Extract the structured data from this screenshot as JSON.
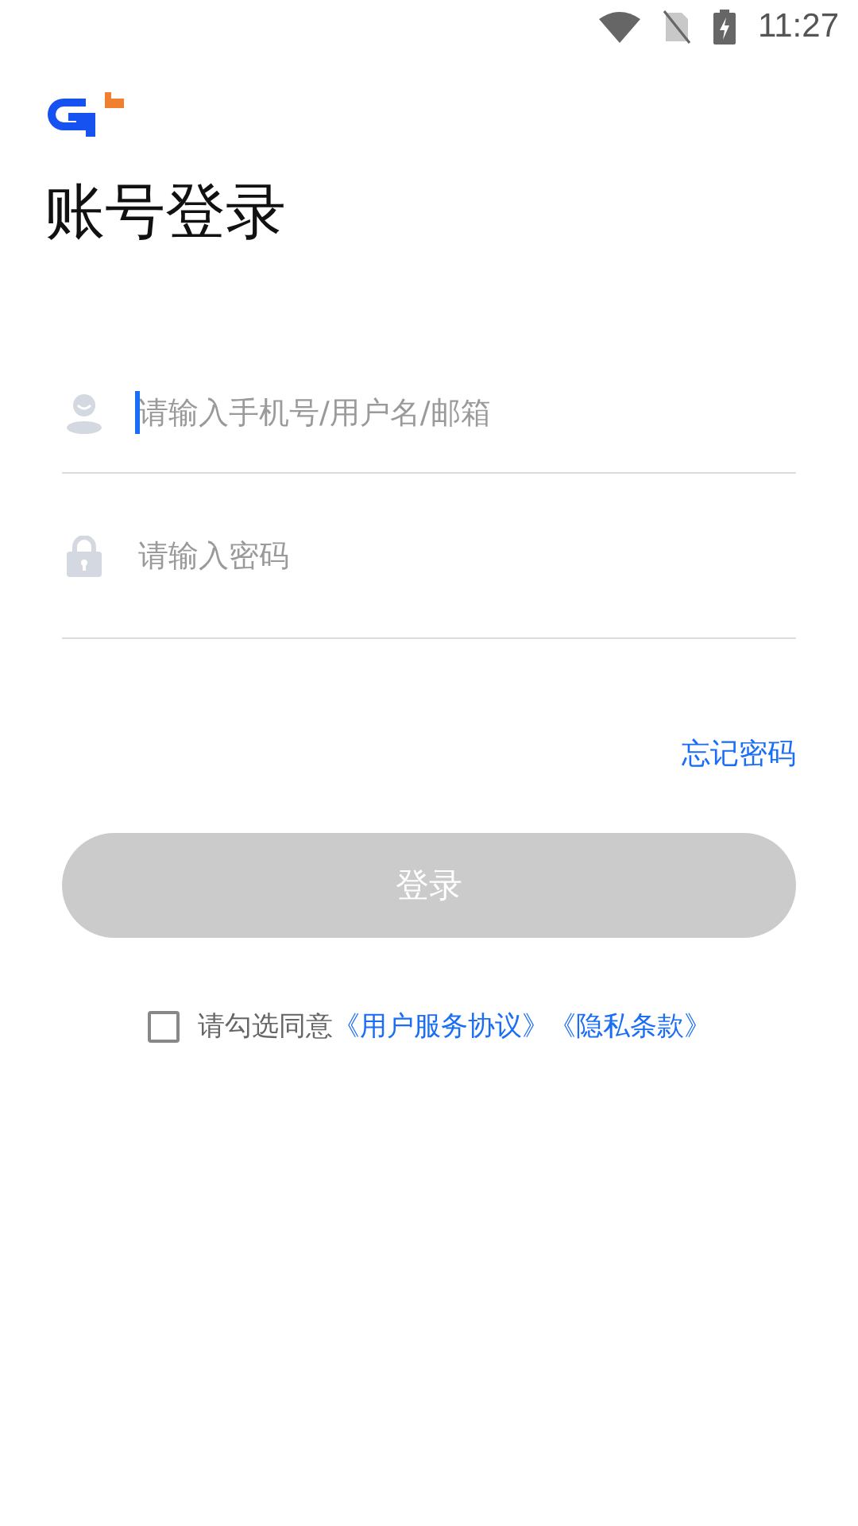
{
  "status_bar": {
    "time": "11:27"
  },
  "title": "账号登录",
  "fields": [
    {
      "kind": "user",
      "placeholder": "请输入手机号/用户名/邮箱",
      "focused": true
    },
    {
      "kind": "password",
      "placeholder": "请输入密码",
      "focused": false
    }
  ],
  "forgot_password": "忘记密码",
  "login_button": {
    "label": "登录",
    "disabled": true
  },
  "agreement": {
    "checked": false,
    "text": "请勾选同意",
    "links": [
      "《用户服务协议》",
      "《隐私条款》"
    ]
  }
}
